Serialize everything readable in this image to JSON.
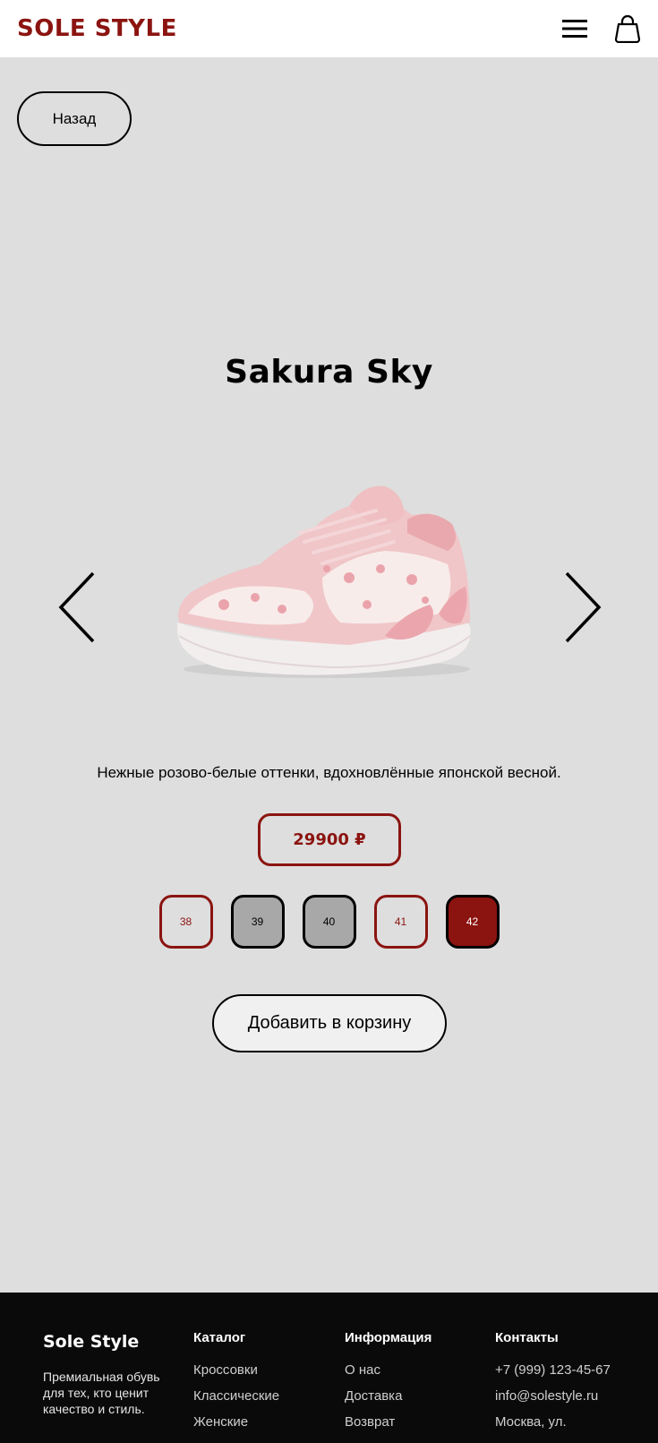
{
  "header": {
    "logo": "SOLE STYLE",
    "menu_icon": "hamburger-menu-icon",
    "cart_icon": "shopping-bag-icon"
  },
  "back_label": "Назад",
  "product": {
    "title": "Sakura Sky",
    "image_icon": "sneaker-image",
    "description": "Нежные розово-белые оттенки, вдохновлённые японской весной.",
    "price": "29900 ₽",
    "sizes": [
      {
        "label": "38",
        "state": "available"
      },
      {
        "label": "39",
        "state": "unavailable"
      },
      {
        "label": "40",
        "state": "unavailable"
      },
      {
        "label": "41",
        "state": "available"
      },
      {
        "label": "42",
        "state": "selected"
      }
    ],
    "add_to_cart": "Добавить в корзину"
  },
  "carousel": {
    "prev_icon": "chevron-left-icon",
    "next_icon": "chevron-right-icon"
  },
  "footer": {
    "brand": "Sole Style",
    "tagline": "Премиальная обувь для тех, кто ценит качество и стиль.",
    "catalog": {
      "heading": "Каталог",
      "links": [
        "Кроссовки",
        "Классические",
        "Женские"
      ]
    },
    "info": {
      "heading": "Информация",
      "links": [
        "О нас",
        "Доставка",
        "Возврат"
      ]
    },
    "contacts": {
      "heading": "Контакты",
      "links": [
        "+7 (999) 123-45-67",
        "info@solestyle.ru",
        "Москва, ул."
      ]
    }
  },
  "colors": {
    "accent": "#8b1410",
    "background": "#dedede",
    "footer": "#0a0a0a"
  }
}
